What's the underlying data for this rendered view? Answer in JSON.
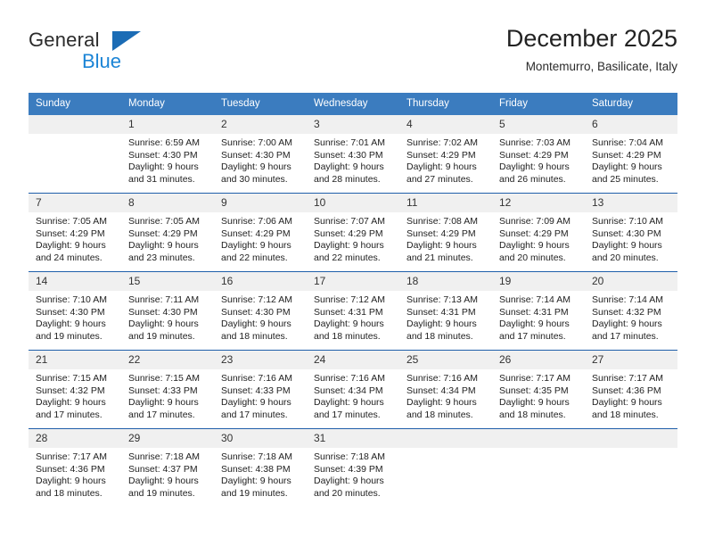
{
  "brand": {
    "name_part1": "General",
    "name_part2": "Blue",
    "triangle_icon": "blue-triangle-icon",
    "accent_dark": "#1b6cb5",
    "accent_light": "#1b84d6"
  },
  "header": {
    "title": "December 2025",
    "subtitle": "Montemurro, Basilicate, Italy"
  },
  "theme": {
    "header_bg": "#3b7cbf",
    "row_divider": "#1f5faa",
    "daynum_bg": "#f0f0f0"
  },
  "weekdays": [
    "Sunday",
    "Monday",
    "Tuesday",
    "Wednesday",
    "Thursday",
    "Friday",
    "Saturday"
  ],
  "weeks": [
    [
      {
        "day": "",
        "sunrise": "",
        "sunset": "",
        "daylight1": "",
        "daylight2": ""
      },
      {
        "day": "1",
        "sunrise": "Sunrise: 6:59 AM",
        "sunset": "Sunset: 4:30 PM",
        "daylight1": "Daylight: 9 hours",
        "daylight2": "and 31 minutes."
      },
      {
        "day": "2",
        "sunrise": "Sunrise: 7:00 AM",
        "sunset": "Sunset: 4:30 PM",
        "daylight1": "Daylight: 9 hours",
        "daylight2": "and 30 minutes."
      },
      {
        "day": "3",
        "sunrise": "Sunrise: 7:01 AM",
        "sunset": "Sunset: 4:30 PM",
        "daylight1": "Daylight: 9 hours",
        "daylight2": "and 28 minutes."
      },
      {
        "day": "4",
        "sunrise": "Sunrise: 7:02 AM",
        "sunset": "Sunset: 4:29 PM",
        "daylight1": "Daylight: 9 hours",
        "daylight2": "and 27 minutes."
      },
      {
        "day": "5",
        "sunrise": "Sunrise: 7:03 AM",
        "sunset": "Sunset: 4:29 PM",
        "daylight1": "Daylight: 9 hours",
        "daylight2": "and 26 minutes."
      },
      {
        "day": "6",
        "sunrise": "Sunrise: 7:04 AM",
        "sunset": "Sunset: 4:29 PM",
        "daylight1": "Daylight: 9 hours",
        "daylight2": "and 25 minutes."
      }
    ],
    [
      {
        "day": "7",
        "sunrise": "Sunrise: 7:05 AM",
        "sunset": "Sunset: 4:29 PM",
        "daylight1": "Daylight: 9 hours",
        "daylight2": "and 24 minutes."
      },
      {
        "day": "8",
        "sunrise": "Sunrise: 7:05 AM",
        "sunset": "Sunset: 4:29 PM",
        "daylight1": "Daylight: 9 hours",
        "daylight2": "and 23 minutes."
      },
      {
        "day": "9",
        "sunrise": "Sunrise: 7:06 AM",
        "sunset": "Sunset: 4:29 PM",
        "daylight1": "Daylight: 9 hours",
        "daylight2": "and 22 minutes."
      },
      {
        "day": "10",
        "sunrise": "Sunrise: 7:07 AM",
        "sunset": "Sunset: 4:29 PM",
        "daylight1": "Daylight: 9 hours",
        "daylight2": "and 22 minutes."
      },
      {
        "day": "11",
        "sunrise": "Sunrise: 7:08 AM",
        "sunset": "Sunset: 4:29 PM",
        "daylight1": "Daylight: 9 hours",
        "daylight2": "and 21 minutes."
      },
      {
        "day": "12",
        "sunrise": "Sunrise: 7:09 AM",
        "sunset": "Sunset: 4:29 PM",
        "daylight1": "Daylight: 9 hours",
        "daylight2": "and 20 minutes."
      },
      {
        "day": "13",
        "sunrise": "Sunrise: 7:10 AM",
        "sunset": "Sunset: 4:30 PM",
        "daylight1": "Daylight: 9 hours",
        "daylight2": "and 20 minutes."
      }
    ],
    [
      {
        "day": "14",
        "sunrise": "Sunrise: 7:10 AM",
        "sunset": "Sunset: 4:30 PM",
        "daylight1": "Daylight: 9 hours",
        "daylight2": "and 19 minutes."
      },
      {
        "day": "15",
        "sunrise": "Sunrise: 7:11 AM",
        "sunset": "Sunset: 4:30 PM",
        "daylight1": "Daylight: 9 hours",
        "daylight2": "and 19 minutes."
      },
      {
        "day": "16",
        "sunrise": "Sunrise: 7:12 AM",
        "sunset": "Sunset: 4:30 PM",
        "daylight1": "Daylight: 9 hours",
        "daylight2": "and 18 minutes."
      },
      {
        "day": "17",
        "sunrise": "Sunrise: 7:12 AM",
        "sunset": "Sunset: 4:31 PM",
        "daylight1": "Daylight: 9 hours",
        "daylight2": "and 18 minutes."
      },
      {
        "day": "18",
        "sunrise": "Sunrise: 7:13 AM",
        "sunset": "Sunset: 4:31 PM",
        "daylight1": "Daylight: 9 hours",
        "daylight2": "and 18 minutes."
      },
      {
        "day": "19",
        "sunrise": "Sunrise: 7:14 AM",
        "sunset": "Sunset: 4:31 PM",
        "daylight1": "Daylight: 9 hours",
        "daylight2": "and 17 minutes."
      },
      {
        "day": "20",
        "sunrise": "Sunrise: 7:14 AM",
        "sunset": "Sunset: 4:32 PM",
        "daylight1": "Daylight: 9 hours",
        "daylight2": "and 17 minutes."
      }
    ],
    [
      {
        "day": "21",
        "sunrise": "Sunrise: 7:15 AM",
        "sunset": "Sunset: 4:32 PM",
        "daylight1": "Daylight: 9 hours",
        "daylight2": "and 17 minutes."
      },
      {
        "day": "22",
        "sunrise": "Sunrise: 7:15 AM",
        "sunset": "Sunset: 4:33 PM",
        "daylight1": "Daylight: 9 hours",
        "daylight2": "and 17 minutes."
      },
      {
        "day": "23",
        "sunrise": "Sunrise: 7:16 AM",
        "sunset": "Sunset: 4:33 PM",
        "daylight1": "Daylight: 9 hours",
        "daylight2": "and 17 minutes."
      },
      {
        "day": "24",
        "sunrise": "Sunrise: 7:16 AM",
        "sunset": "Sunset: 4:34 PM",
        "daylight1": "Daylight: 9 hours",
        "daylight2": "and 17 minutes."
      },
      {
        "day": "25",
        "sunrise": "Sunrise: 7:16 AM",
        "sunset": "Sunset: 4:34 PM",
        "daylight1": "Daylight: 9 hours",
        "daylight2": "and 18 minutes."
      },
      {
        "day": "26",
        "sunrise": "Sunrise: 7:17 AM",
        "sunset": "Sunset: 4:35 PM",
        "daylight1": "Daylight: 9 hours",
        "daylight2": "and 18 minutes."
      },
      {
        "day": "27",
        "sunrise": "Sunrise: 7:17 AM",
        "sunset": "Sunset: 4:36 PM",
        "daylight1": "Daylight: 9 hours",
        "daylight2": "and 18 minutes."
      }
    ],
    [
      {
        "day": "28",
        "sunrise": "Sunrise: 7:17 AM",
        "sunset": "Sunset: 4:36 PM",
        "daylight1": "Daylight: 9 hours",
        "daylight2": "and 18 minutes."
      },
      {
        "day": "29",
        "sunrise": "Sunrise: 7:18 AM",
        "sunset": "Sunset: 4:37 PM",
        "daylight1": "Daylight: 9 hours",
        "daylight2": "and 19 minutes."
      },
      {
        "day": "30",
        "sunrise": "Sunrise: 7:18 AM",
        "sunset": "Sunset: 4:38 PM",
        "daylight1": "Daylight: 9 hours",
        "daylight2": "and 19 minutes."
      },
      {
        "day": "31",
        "sunrise": "Sunrise: 7:18 AM",
        "sunset": "Sunset: 4:39 PM",
        "daylight1": "Daylight: 9 hours",
        "daylight2": "and 20 minutes."
      },
      {
        "day": "",
        "sunrise": "",
        "sunset": "",
        "daylight1": "",
        "daylight2": ""
      },
      {
        "day": "",
        "sunrise": "",
        "sunset": "",
        "daylight1": "",
        "daylight2": ""
      },
      {
        "day": "",
        "sunrise": "",
        "sunset": "",
        "daylight1": "",
        "daylight2": ""
      }
    ]
  ]
}
